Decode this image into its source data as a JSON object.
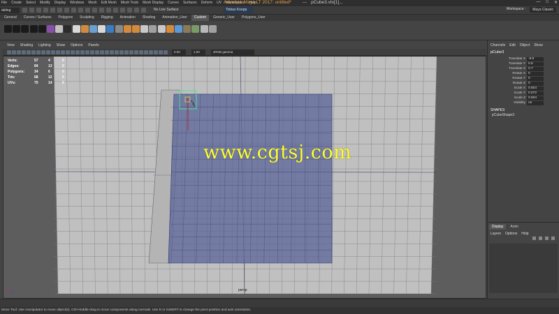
{
  "titlebar": {
    "menus": [
      "File",
      "Create",
      "Select",
      "Modify",
      "Display",
      "Windows",
      "Mesh",
      "Edit Mesh",
      "Mesh Tools",
      "Mesh Display",
      "Curves",
      "Surfaces",
      "Deform",
      "UV",
      "Marketplace",
      "Help"
    ],
    "app_title": "Autodesk Maya LT 2017: untitled*",
    "separator": "---",
    "file": "pCube3.vtx[1]..."
  },
  "statusline": {
    "mode": "deling",
    "live_surface": "No Live Surface",
    "user": "Tobias Koepp",
    "workspace_label": "Workspace :",
    "workspace_value": "Maya Classic"
  },
  "shelf_tabs": [
    "General",
    "Curves / Surfaces",
    "Polygons",
    "Sculpting",
    "Rigging",
    "Animation",
    "Shading",
    "Animation_User",
    "Custom",
    "Generic_User",
    "Polygons_User"
  ],
  "active_shelf_tab": "Custom",
  "shelf_icon_colors": [
    "#1a1a1a",
    "#1a1a1a",
    "#1a1a1a",
    "#1a1a1a",
    "#1a1a1a",
    "#8a4fa8",
    "#c0c0c0",
    "#2b2b2b",
    "#d8d8d8",
    "#d28a3c",
    "#6a9fd0",
    "#d8d8d8",
    "#3c7cc0",
    "#8a8a8a",
    "#d28a3c",
    "#d28a3c",
    "#c8c8c8",
    "#a0a0a0",
    "#c8c8c8",
    "#d88a3c",
    "#5a9ad8",
    "#8a7a5a",
    "#7a9a6a",
    "#b8b8b8",
    "#a0a0a0"
  ],
  "panel_menu": [
    "View",
    "Shading",
    "Lighting",
    "Show",
    "Options",
    "Panels"
  ],
  "panel_toolbar": {
    "near": "0.00",
    "far": "1.00",
    "color_space": "sRGB gamma"
  },
  "hud": [
    {
      "label": "Verts:",
      "a": "57",
      "b": "4",
      "c": "0"
    },
    {
      "label": "Edges:",
      "a": "84",
      "b": "13",
      "c": "0"
    },
    {
      "label": "Polygons:",
      "a": "34",
      "b": "6",
      "c": "0"
    },
    {
      "label": "Tris:",
      "a": "68",
      "b": "12",
      "c": "0"
    },
    {
      "label": "UVs:",
      "a": "75",
      "b": "14",
      "c": "0"
    }
  ],
  "viewport": {
    "camera": "persp",
    "watermark": "www.cgtsj.com"
  },
  "channelbox": {
    "menus": [
      "Channels",
      "Edit",
      "Object",
      "Show"
    ],
    "object": "pCube3",
    "attributes": [
      {
        "name": "Translate X",
        "value": "-9.9"
      },
      {
        "name": "Translate Y",
        "value": "0.5"
      },
      {
        "name": "Translate Z",
        "value": "0.7"
      },
      {
        "name": "Rotate X",
        "value": "0"
      },
      {
        "name": "Rotate Y",
        "value": "0"
      },
      {
        "name": "Rotate Z",
        "value": "0"
      },
      {
        "name": "Scale X",
        "value": "0.504"
      },
      {
        "name": "Scale Y",
        "value": "0.072"
      },
      {
        "name": "Scale Z",
        "value": "0.504"
      },
      {
        "name": "Visibility",
        "value": "on"
      }
    ],
    "shapes_label": "SHAPES",
    "shape_name": "pCubeShape3"
  },
  "layer_editor": {
    "tabs": [
      "Display",
      "Anim"
    ],
    "active_tab": "Display",
    "menus": [
      "Layers",
      "Options",
      "Help"
    ]
  },
  "help_line": "Move Tool: Use manipulator to move object(s). Ctrl+middle-drag to move components along normals. Use D or INSERT to change the pivot position and axis orientation."
}
